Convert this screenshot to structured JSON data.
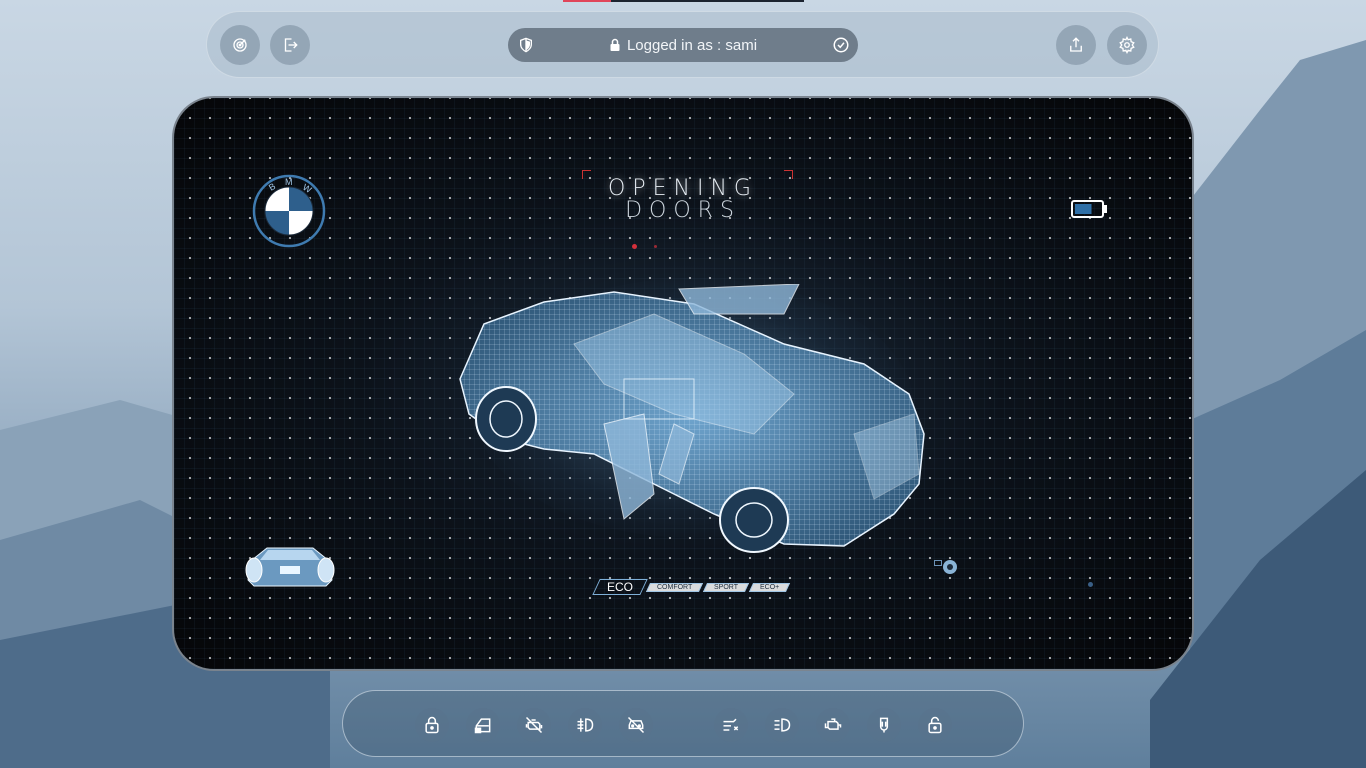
{
  "topbar": {
    "login_text": "Logged in as : sami",
    "progress_fraction": 0.2,
    "left_buttons": [
      {
        "name": "radar-icon"
      },
      {
        "name": "logout-icon"
      }
    ],
    "right_buttons": [
      {
        "name": "share-icon"
      },
      {
        "name": "settings-icon"
      }
    ]
  },
  "panel": {
    "brand_logo_text": "BMW",
    "title_line1": "OPENING",
    "title_line2": "DOORS",
    "battery_level": 0.66,
    "modes": [
      {
        "label": "ECO",
        "active": true
      },
      {
        "label": "COMFORT",
        "active": false
      },
      {
        "label": "SPORT",
        "active": false
      },
      {
        "label": "ECO+",
        "active": false
      }
    ]
  },
  "controls": [
    {
      "name": "lock-icon"
    },
    {
      "name": "car-door-open-icon"
    },
    {
      "name": "engine-off-icon"
    },
    {
      "name": "fog-light-icon"
    },
    {
      "name": "car-off-icon"
    },
    {
      "name": "exhaust-icon"
    },
    {
      "name": "headlight-icon"
    },
    {
      "name": "engine-icon"
    },
    {
      "name": "seatbelt-icon"
    },
    {
      "name": "unlock-icon"
    }
  ],
  "colors": {
    "accent_red": "#d3303b",
    "accent_blue": "#89b3d6"
  }
}
